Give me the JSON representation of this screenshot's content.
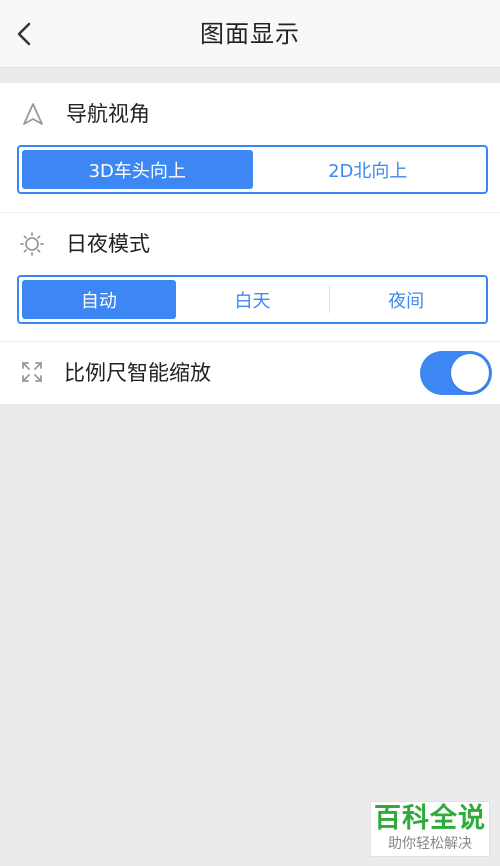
{
  "header": {
    "title": "图面显示",
    "back_icon": "chevron-left-icon"
  },
  "nav_angle": {
    "icon": "navigation-arrow-icon",
    "title": "导航视角",
    "options": [
      "3D车头向上",
      "2D北向上"
    ],
    "selected": "3D车头向上"
  },
  "day_night": {
    "icon": "sun-icon",
    "title": "日夜模式",
    "options": [
      "自动",
      "白天",
      "夜间"
    ],
    "selected": "自动"
  },
  "scale_zoom": {
    "icon": "expand-icon",
    "label": "比例尺智能缩放",
    "enabled": true
  },
  "colors": {
    "accent": "#3d87f5",
    "background": "#ebebeb",
    "watermark_green": "#2fab3a"
  },
  "watermark": {
    "title": "百科全说",
    "subtitle": "助你轻松解决"
  }
}
